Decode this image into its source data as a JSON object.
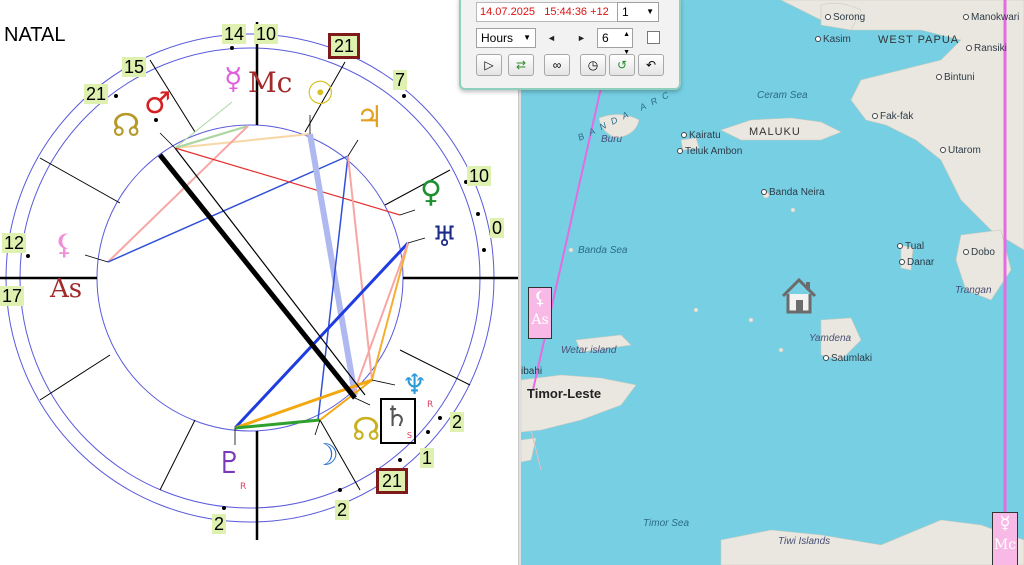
{
  "chart": {
    "title": "NATAL",
    "top_labels": {
      "mc_left": "14",
      "mc_right": "10",
      "boxed_top": "21",
      "top_right": "7",
      "left_upper": "15",
      "left_upper2": "21",
      "right_mid": "10",
      "right_zero": "0",
      "asc_upper": "12",
      "asc_lower": "17",
      "bottom_2a": "2",
      "bottom_2b": "2",
      "bottom_1": "1",
      "bottom_2c": "2",
      "boxed_bottom": "21"
    },
    "glyphs": {
      "mars": "♂",
      "node": "☊",
      "mercury_mc": "☿",
      "mc": "Mc",
      "sun": "☉",
      "jupiter": "♃",
      "venus": "♀",
      "uranus": "♅",
      "lilith": "⚸",
      "asc": "As",
      "neptune": "♆",
      "saturn": "♄",
      "node2": "☊",
      "moon": "☽",
      "pluto": "♇"
    },
    "retro": {
      "neptune": "R",
      "saturn": "S",
      "pluto": "R"
    }
  },
  "toolbar": {
    "date": "14.07.2025",
    "time": "15:44:36 +12",
    "step_select": "1",
    "unit_select": "Hours",
    "step_value": "6",
    "arrow_left": "◄",
    "arrow_right": "►",
    "buttons": [
      "play-icon",
      "transfer-icon",
      "link-icon",
      "clock-icon",
      "reset-icon",
      "back-icon"
    ]
  },
  "map": {
    "labels": [
      {
        "text": "Sorong",
        "type": "town"
      },
      {
        "text": "Manokwari",
        "type": "town"
      },
      {
        "text": "Kasim",
        "type": "town"
      },
      {
        "text": "WEST PAPUA",
        "type": "region"
      },
      {
        "text": "Ransiki",
        "type": "town"
      },
      {
        "text": "Bintuni",
        "type": "town"
      },
      {
        "text": "BANDA ARC",
        "type": "arc"
      },
      {
        "text": "Ceram Sea",
        "type": "sea"
      },
      {
        "text": "Buru",
        "type": "island"
      },
      {
        "text": "Kairatu",
        "type": "town"
      },
      {
        "text": "MALUKU",
        "type": "region"
      },
      {
        "text": "Teluk Ambon",
        "type": "town"
      },
      {
        "text": "Fak-fak",
        "type": "town"
      },
      {
        "text": "Utarom",
        "type": "town"
      },
      {
        "text": "Banda Neira",
        "type": "town"
      },
      {
        "text": "Banda Sea",
        "type": "sea"
      },
      {
        "text": "Tual",
        "type": "town"
      },
      {
        "text": "Dobo",
        "type": "town"
      },
      {
        "text": "Danar",
        "type": "town"
      },
      {
        "text": "Trangan",
        "type": "island"
      },
      {
        "text": "Yamdena",
        "type": "island"
      },
      {
        "text": "Saumlaki",
        "type": "town"
      },
      {
        "text": "Wetar island",
        "type": "island"
      },
      {
        "text": "ibahi",
        "type": "town"
      },
      {
        "text": "Timor-Leste",
        "type": "country"
      },
      {
        "text": "Timor Sea",
        "type": "sea"
      },
      {
        "text": "Tiwi Islands",
        "type": "island"
      }
    ],
    "line_tags": {
      "asc_glyph": "⚸",
      "asc_text": "As",
      "mc_glyph": "☿",
      "mc_text": "Mc"
    },
    "home_icon": "home-icon",
    "colors": {
      "water": "#76cfe3",
      "land": "#e9e7df",
      "line": "#e66be0"
    }
  }
}
